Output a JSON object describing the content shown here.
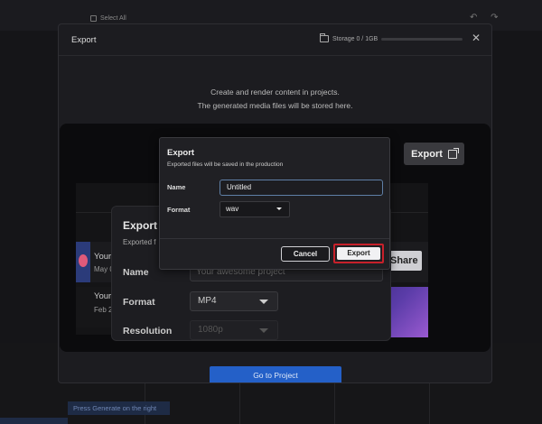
{
  "background": {
    "select_all": "Select All",
    "undo_redo": "↶ ↷",
    "generate_hint": "Press Generate on the right"
  },
  "export_modal": {
    "title": "Export",
    "storage": "Storage 0 / 1GB",
    "close": "✕",
    "empty_line1": "Create and render content in projects.",
    "empty_line2": "The generated media files will be stored here.",
    "go_to_project": "Go to Project",
    "export_button": "Export"
  },
  "projects": [
    {
      "name": "Your",
      "date": "May 0"
    },
    {
      "name": "Your",
      "date": "Feb 2"
    }
  ],
  "share_button": "Share",
  "export_dialog_back": {
    "title": "Export",
    "subtitle": "Exported f",
    "name_label": "Name",
    "name_placeholder": "Your awesome project",
    "format_label": "Format",
    "format_value": "MP4",
    "resolution_label": "Resolution",
    "resolution_value": "1080p"
  },
  "export_dialog_front": {
    "title": "Export",
    "subtitle": "Exported files will be saved in the production",
    "name_label": "Name",
    "name_value": "Untitled",
    "format_label": "Format",
    "format_value": "wav",
    "cancel": "Cancel",
    "export": "Export"
  },
  "colors": {
    "primary_blue": "#2460c8",
    "highlight_red": "#c8202a",
    "dialog_bg": "#202024"
  }
}
